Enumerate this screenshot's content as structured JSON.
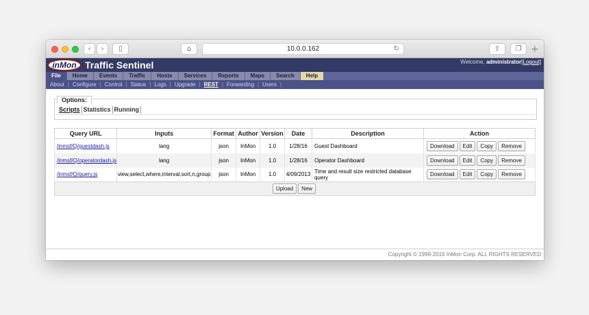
{
  "browser": {
    "url": "10.0.0.162",
    "icons": {
      "back": "chevron-left-icon",
      "forward": "chevron-right-icon",
      "sidebar": "sidebar-icon",
      "home": "home-icon",
      "reload": "reload-icon",
      "share": "share-icon",
      "tabs": "tabs-icon",
      "new_tab": "plus-icon"
    }
  },
  "header": {
    "logo": "inMon",
    "title": "Traffic Sentinel",
    "welcome_prefix": "Welcome,",
    "user": "administrator",
    "logout": "[Logout]"
  },
  "main_nav": [
    "File",
    "Home",
    "Events",
    "Traffic",
    "Hosts",
    "Services",
    "Reports",
    "Maps",
    "Search",
    "Help"
  ],
  "sub_nav": [
    "About",
    "Configure",
    "Control",
    "Status",
    "Logs",
    "Upgrade",
    "REST",
    "Forwarding",
    "Users"
  ],
  "options": {
    "legend": "Options:",
    "tabs": [
      "Scripts",
      "Statistics",
      "Running"
    ]
  },
  "table": {
    "headers": [
      "Query URL",
      "Inputs",
      "Format",
      "Author",
      "Version",
      "Date",
      "Description",
      "Action"
    ],
    "rows": [
      {
        "url": "/inmsf/Q/guestdash.js",
        "inputs": "lang",
        "format": "json",
        "author": "InMon",
        "version": "1.0",
        "date": "1/28/16",
        "description": "Guest Dashboard"
      },
      {
        "url": "/inmsf/Q/operatordash.js",
        "inputs": "lang",
        "format": "json",
        "author": "InMon",
        "version": "1.0",
        "date": "1/28/16",
        "description": "Operator Dashboard"
      },
      {
        "url": "/inmsf/Q/query.js",
        "inputs": "view,select,where,interval,sort,n,group",
        "format": "json",
        "author": "InMon",
        "version": "1.0",
        "date": "4/09/2013",
        "description": "Time and result size restricted database query"
      }
    ],
    "actions": [
      "Download",
      "Edit",
      "Copy",
      "Remove"
    ],
    "footer_buttons": [
      "Upload",
      "New"
    ]
  },
  "footer": {
    "copyright": "Copyright © 1999-2016 InMon Corp. ALL RIGHTS RESERVED"
  },
  "colors": {
    "header_bg": "#333a66",
    "nav_bg": "#5e6599",
    "subnav_bg": "#4b5287",
    "help_tab": "#e2d9a6",
    "link": "#1a1acc"
  }
}
